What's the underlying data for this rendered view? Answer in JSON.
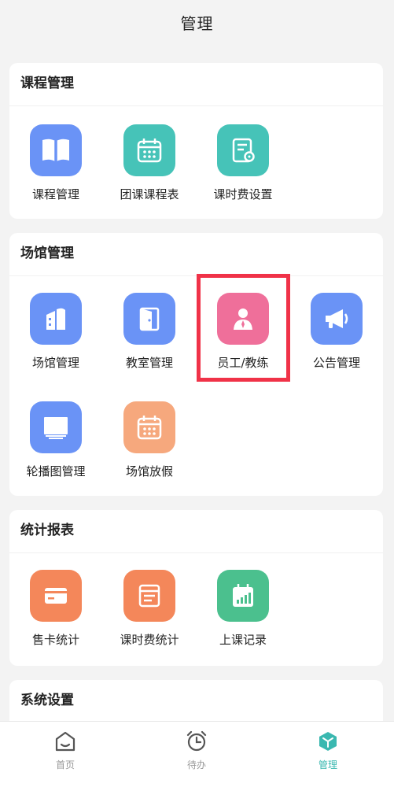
{
  "header": {
    "title": "管理"
  },
  "sections": {
    "course": {
      "title": "课程管理",
      "items": [
        {
          "label": "课程管理",
          "icon": "book-icon",
          "color": "#6a93f6"
        },
        {
          "label": "团课课程表",
          "icon": "calendar-icon",
          "color": "#46c3b8"
        },
        {
          "label": "课时费设置",
          "icon": "document-settings-icon",
          "color": "#46c3b8"
        }
      ]
    },
    "venue": {
      "title": "场馆管理",
      "items": [
        {
          "label": "场馆管理",
          "icon": "building-icon",
          "color": "#6a93f6"
        },
        {
          "label": "教室管理",
          "icon": "door-icon",
          "color": "#6a93f6"
        },
        {
          "label": "员工/教练",
          "icon": "staff-icon",
          "color": "#ef6f9a"
        },
        {
          "label": "公告管理",
          "icon": "megaphone-icon",
          "color": "#6a93f6"
        },
        {
          "label": "轮播图管理",
          "icon": "carousel-icon",
          "color": "#6a93f6"
        },
        {
          "label": "场馆放假",
          "icon": "holiday-calendar-icon",
          "color": "#f6a87d"
        }
      ]
    },
    "stats": {
      "title": "统计报表",
      "items": [
        {
          "label": "售卡统计",
          "icon": "card-icon",
          "color": "#f4875a"
        },
        {
          "label": "课时费统计",
          "icon": "fee-report-icon",
          "color": "#f4875a"
        },
        {
          "label": "上课记录",
          "icon": "bar-chart-icon",
          "color": "#4bc08e"
        }
      ]
    },
    "system": {
      "title": "系统设置"
    }
  },
  "tabbar": {
    "items": [
      {
        "label": "首页",
        "icon": "home-icon",
        "active": false
      },
      {
        "label": "待办",
        "icon": "alarm-clock-icon",
        "active": false
      },
      {
        "label": "管理",
        "icon": "cube-icon",
        "active": true
      }
    ],
    "active_color": "#3ab8b0"
  },
  "highlight": {
    "target": "员工/教练",
    "color": "#f03248"
  }
}
